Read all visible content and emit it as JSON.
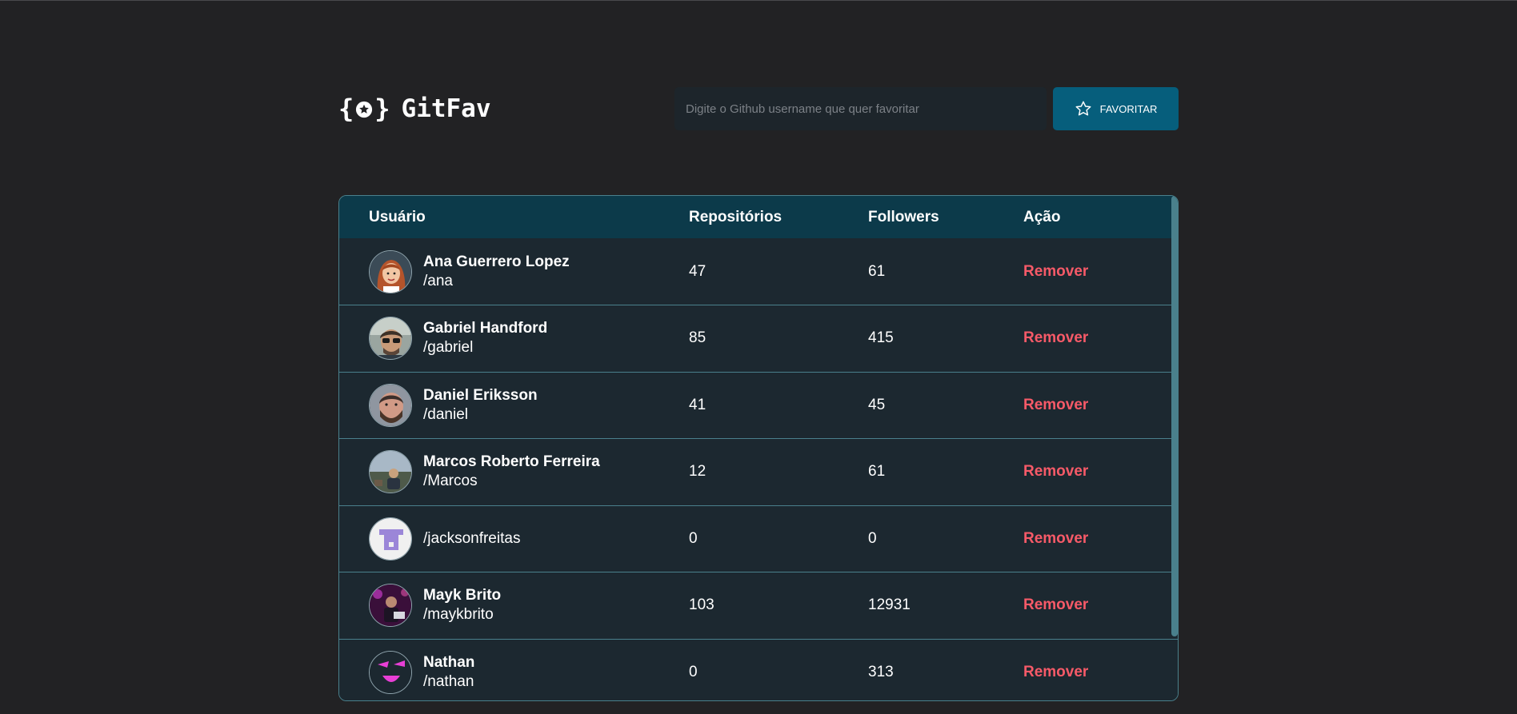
{
  "brand": {
    "name": "GitFav"
  },
  "search": {
    "placeholder": "Digite o Github username que quer favoritar",
    "button_label": "FAVORITAR"
  },
  "table": {
    "headers": {
      "user": "Usuário",
      "repos": "Repositórios",
      "followers": "Followers",
      "action": "Ação"
    },
    "rows": [
      {
        "name": "Ana Guerrero Lopez",
        "login": "/ana",
        "repos": "47",
        "followers": "61",
        "action": "Remover",
        "avatar_icon": "cartoon-woman-avatar"
      },
      {
        "name": "Gabriel Handford",
        "login": "/gabriel",
        "repos": "85",
        "followers": "415",
        "action": "Remover",
        "avatar_icon": "man-with-sunglasses-avatar"
      },
      {
        "name": "Daniel Eriksson",
        "login": "/daniel",
        "repos": "41",
        "followers": "45",
        "action": "Remover",
        "avatar_icon": "bearded-man-avatar"
      },
      {
        "name": "Marcos Roberto Ferreira",
        "login": "/Marcos",
        "repos": "12",
        "followers": "61",
        "action": "Remover",
        "avatar_icon": "outdoor-photo-avatar"
      },
      {
        "name": "",
        "login": "/jacksonfreitas",
        "repos": "0",
        "followers": "0",
        "action": "Remover",
        "avatar_icon": "identicon-avatar"
      },
      {
        "name": "Mayk Brito",
        "login": "/maykbrito",
        "repos": "103",
        "followers": "12931",
        "action": "Remover",
        "avatar_icon": "purple-stage-avatar"
      },
      {
        "name": "Nathan",
        "login": "/nathan",
        "repos": "0",
        "followers": "313",
        "action": "Remover",
        "avatar_icon": "pink-face-avatar"
      }
    ]
  },
  "colors": {
    "background": "#222224",
    "accent": "#065e7c",
    "header_row": "#0c3a4a",
    "danger": "#f75a68",
    "border": "#4a808c"
  }
}
